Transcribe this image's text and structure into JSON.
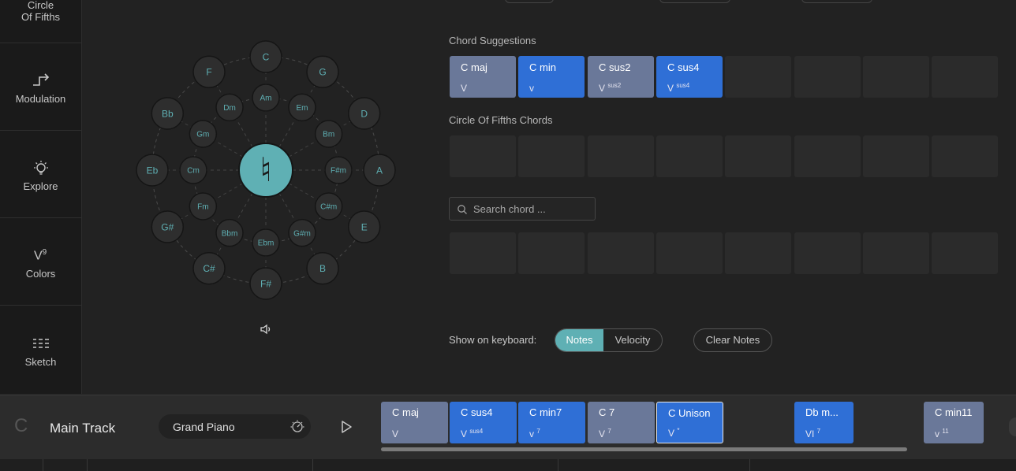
{
  "sidebar": {
    "items": [
      {
        "label": "Circle",
        "label2": "Of Fifths",
        "icon": "circle-of-fifths-icon"
      },
      {
        "label": "Modulation",
        "icon": "modulation-icon"
      },
      {
        "label": "Explore",
        "icon": "lightbulb-icon"
      },
      {
        "label": "Colors",
        "icon": "colors-icon",
        "glyph": "V",
        "glyph_sup": "9"
      },
      {
        "label": "Sketch",
        "icon": "sketch-grid-icon"
      }
    ]
  },
  "circle": {
    "outer": [
      "C",
      "G",
      "D",
      "A",
      "E",
      "B",
      "F#",
      "C#",
      "G#",
      "Eb",
      "Bb",
      "F"
    ],
    "inner": [
      "Am",
      "Em",
      "Bm",
      "F#m",
      "C#m",
      "G#m",
      "Ebm",
      "Bbm",
      "Fm",
      "Cm",
      "Gm",
      "Dm"
    ],
    "center_glyph": "♮",
    "accent": "#5fb0b4"
  },
  "suggestions": {
    "title": "Chord Suggestions",
    "chords": [
      {
        "name": "C maj",
        "roman": "V",
        "sup": "",
        "style": "grey"
      },
      {
        "name": "C min",
        "roman": "v",
        "sup": "",
        "style": "blue"
      },
      {
        "name": "C sus2",
        "roman": "V",
        "sup": "sus2",
        "style": "grey"
      },
      {
        "name": "C sus4",
        "roman": "V",
        "sup": "sus4",
        "style": "blue"
      }
    ]
  },
  "fifths_chords": {
    "title": "Circle Of Fifths Chords"
  },
  "search": {
    "placeholder": "Search chord ..."
  },
  "keyboard": {
    "label": "Show on keyboard:",
    "notes": "Notes",
    "velocity": "Velocity",
    "clear": "Clear Notes"
  },
  "track": {
    "key": "C",
    "name": "Main Track",
    "instrument": "Grand Piano",
    "chords": [
      {
        "name": "C maj",
        "roman": "V",
        "sup": "",
        "style": "grey"
      },
      {
        "name": "C sus4",
        "roman": "V",
        "sup": "sus4",
        "style": "blue"
      },
      {
        "name": "C min7",
        "roman": "v",
        "sup": "7",
        "style": "blue"
      },
      {
        "name": "C 7",
        "roman": "V",
        "sup": "7",
        "style": "grey"
      },
      {
        "name": "C Unison",
        "roman": "V",
        "sup": "*",
        "style": "blue"
      },
      {
        "name": "Db m...",
        "roman": "VI",
        "sup": "7",
        "style": "blue"
      },
      {
        "name": "C min11",
        "roman": "v",
        "sup": "11",
        "style": "grey"
      }
    ]
  },
  "colors": {
    "grey_chip": "#6a7899",
    "blue_chip": "#2f6fd6",
    "accent": "#5fb0b4"
  }
}
